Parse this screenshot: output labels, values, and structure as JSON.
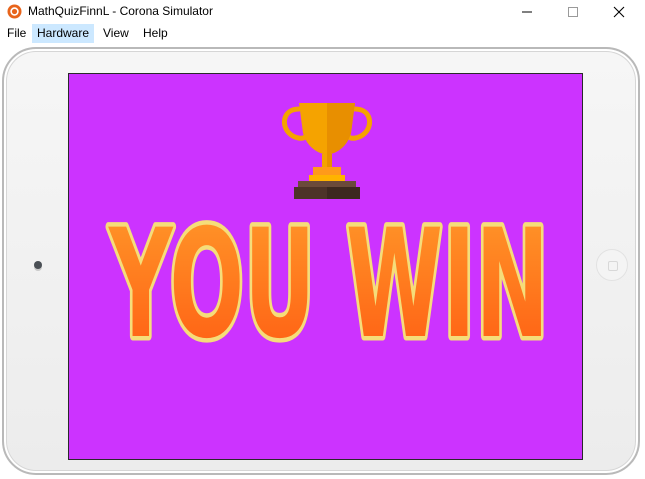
{
  "window": {
    "title": "MathQuizFinnL - Corona Simulator",
    "app_icon": "corona-app-icon",
    "controls": {
      "minimize_icon": "minimize-icon",
      "maximize_icon": "maximize-icon",
      "close_icon": "close-icon"
    }
  },
  "menu": {
    "items": [
      {
        "label": "File"
      },
      {
        "label": "Hardware"
      },
      {
        "label": "View"
      },
      {
        "label": "Help"
      }
    ],
    "highlighted": "Hardware"
  },
  "device": {
    "type": "tablet",
    "camera_icon": "front-camera-dot",
    "home_button_icon": "home-button"
  },
  "screen": {
    "background_color": "#cc33ff",
    "trophy_icon": "trophy-icon",
    "win_text": "YOU WIN",
    "win_text_fill": "#ff7a1c",
    "win_text_outline": "#f5dd7a"
  }
}
